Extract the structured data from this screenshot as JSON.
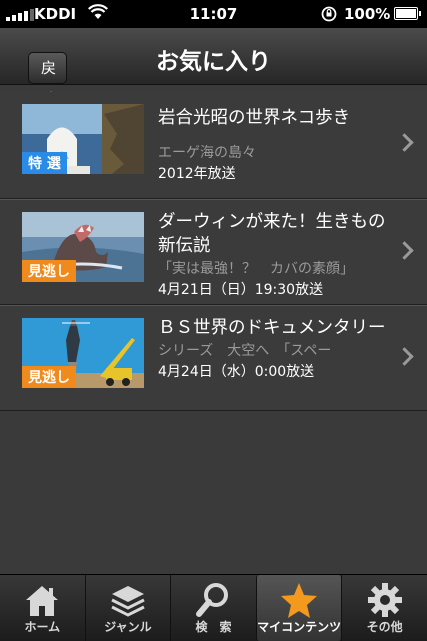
{
  "status": {
    "carrier": "KDDI",
    "time": "11:07",
    "battery": "100%"
  },
  "nav": {
    "back_label": "戻る",
    "title": "お気に入り"
  },
  "items": [
    {
      "title": "岩合光昭の世界ネコ歩き",
      "subtitle": "エーゲ海の島々",
      "date": "2012年放送",
      "badge": "特 選",
      "badge_color": "#2a8be6"
    },
    {
      "title": "ダーウィンが来た！生きもの新伝説",
      "subtitle": "「実は最強！？　カバの素顔」",
      "date": "4月21日（日）19:30放送",
      "badge": "見逃し",
      "badge_color": "#f08a1c"
    },
    {
      "title": "ＢＳ世界のドキュメンタリー",
      "subtitle": "シリーズ　大空へ　「スペー",
      "date": "4月24日（水）0:00放送",
      "badge": "見逃し",
      "badge_color": "#f08a1c"
    }
  ],
  "tabs": [
    {
      "label": "ホーム",
      "icon": "home-icon"
    },
    {
      "label": "ジャンル",
      "icon": "layers-icon"
    },
    {
      "label": "検　索",
      "icon": "search-icon"
    },
    {
      "label": "マイコンテンツ",
      "icon": "star-icon",
      "active": true
    },
    {
      "label": "その他",
      "icon": "gear-icon"
    }
  ],
  "colors": {
    "accent_star": "#f39a1e",
    "badge_blue": "#2a8be6",
    "badge_orange": "#f08a1c"
  }
}
